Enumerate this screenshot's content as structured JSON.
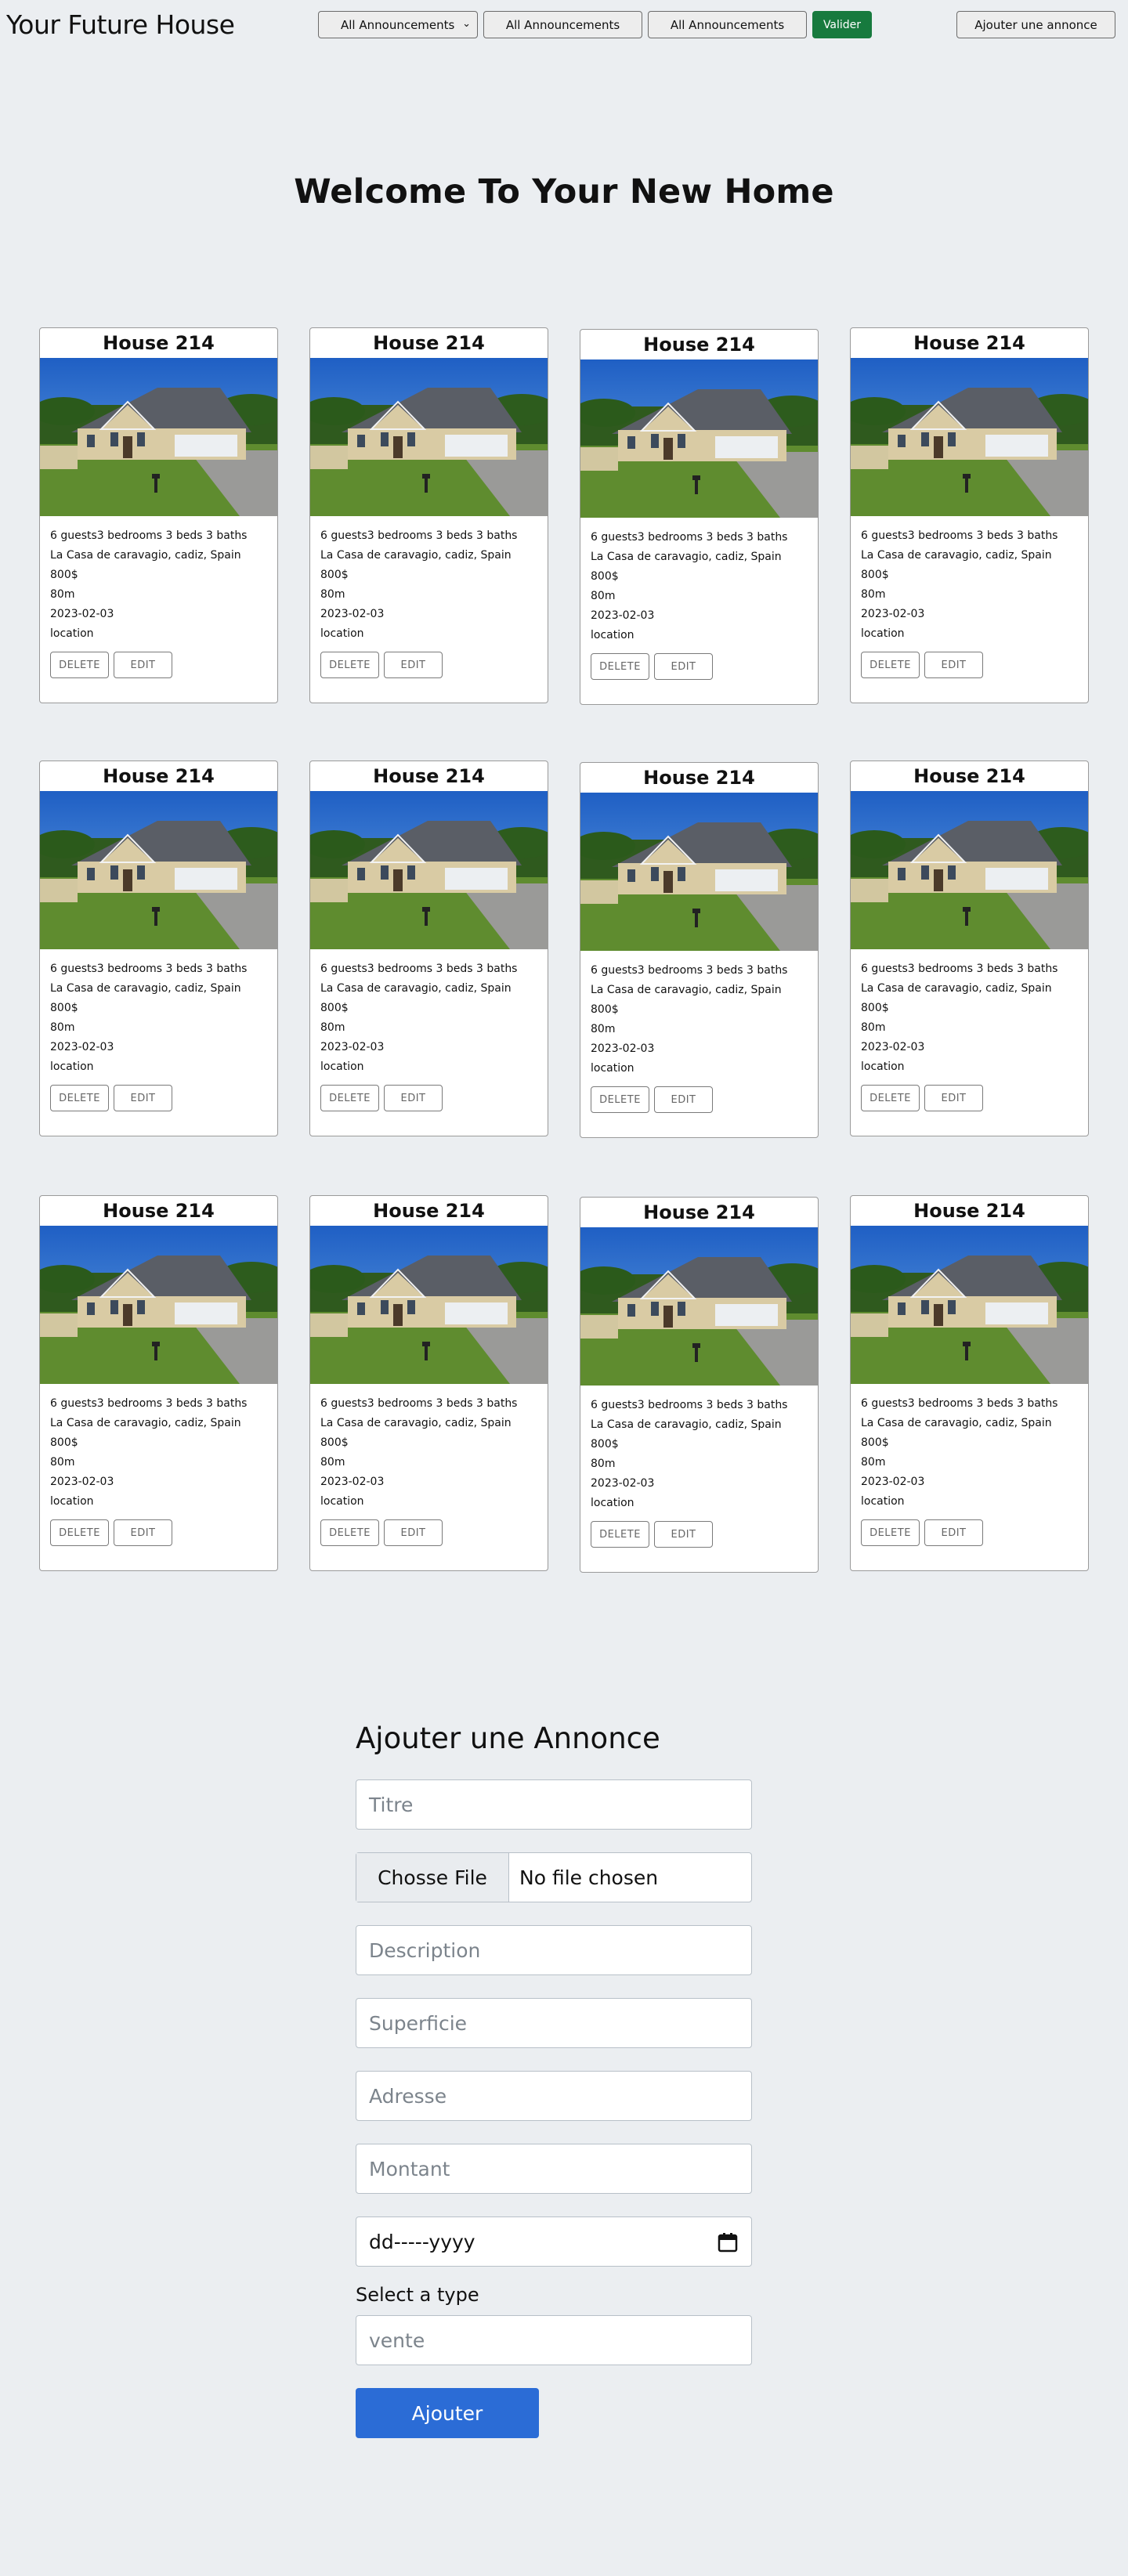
{
  "header": {
    "site_title": "Your Future House",
    "filter_select": "All Announcements",
    "button_2": "All Announcements",
    "button_3": "All Announcements",
    "valider": "Valider",
    "add_announcement": "Ajouter une annonce"
  },
  "welcome": "Welcome To Your New Home",
  "cards": [
    {
      "title": "House 214",
      "guests": "6 guests3 bedrooms 3 beds 3 baths",
      "address": "La Casa de caravagio, cadiz, Spain",
      "price": "800$",
      "area": "80m",
      "date": "2023-02-03",
      "location": "location",
      "delete": "DELETE",
      "edit": "EDIT"
    },
    {
      "title": "House 214",
      "guests": "6 guests3 bedrooms 3 beds 3 baths",
      "address": "La Casa de caravagio, cadiz, Spain",
      "price": "800$",
      "area": "80m",
      "date": "2023-02-03",
      "location": "location",
      "delete": "DELETE",
      "edit": "EDIT"
    },
    {
      "title": "House 214",
      "guests": "6 guests3 bedrooms 3 beds 3 baths",
      "address": "La Casa de caravagio, cadiz, Spain",
      "price": "800$",
      "area": "80m",
      "date": "2023-02-03",
      "location": "location",
      "delete": "DELETE",
      "edit": "EDIT"
    },
    {
      "title": "House 214",
      "guests": "6 guests3 bedrooms 3 beds 3 baths",
      "address": "La Casa de caravagio, cadiz, Spain",
      "price": "800$",
      "area": "80m",
      "date": "2023-02-03",
      "location": "location",
      "delete": "DELETE",
      "edit": "EDIT"
    },
    {
      "title": "House 214",
      "guests": "6 guests3 bedrooms 3 beds 3 baths",
      "address": "La Casa de caravagio, cadiz, Spain",
      "price": "800$",
      "area": "80m",
      "date": "2023-02-03",
      "location": "location",
      "delete": "DELETE",
      "edit": "EDIT"
    },
    {
      "title": "House 214",
      "guests": "6 guests3 bedrooms 3 beds 3 baths",
      "address": "La Casa de caravagio, cadiz, Spain",
      "price": "800$",
      "area": "80m",
      "date": "2023-02-03",
      "location": "location",
      "delete": "DELETE",
      "edit": "EDIT"
    },
    {
      "title": "House 214",
      "guests": "6 guests3 bedrooms 3 beds 3 baths",
      "address": "La Casa de caravagio, cadiz, Spain",
      "price": "800$",
      "area": "80m",
      "date": "2023-02-03",
      "location": "location",
      "delete": "DELETE",
      "edit": "EDIT"
    },
    {
      "title": "House 214",
      "guests": "6 guests3 bedrooms 3 beds 3 baths",
      "address": "La Casa de caravagio, cadiz, Spain",
      "price": "800$",
      "area": "80m",
      "date": "2023-02-03",
      "location": "location",
      "delete": "DELETE",
      "edit": "EDIT"
    },
    {
      "title": "House 214",
      "guests": "6 guests3 bedrooms 3 beds 3 baths",
      "address": "La Casa de caravagio, cadiz, Spain",
      "price": "800$",
      "area": "80m",
      "date": "2023-02-03",
      "location": "location",
      "delete": "DELETE",
      "edit": "EDIT"
    },
    {
      "title": "House 214",
      "guests": "6 guests3 bedrooms 3 beds 3 baths",
      "address": "La Casa de caravagio, cadiz, Spain",
      "price": "800$",
      "area": "80m",
      "date": "2023-02-03",
      "location": "location",
      "delete": "DELETE",
      "edit": "EDIT"
    },
    {
      "title": "House 214",
      "guests": "6 guests3 bedrooms 3 beds 3 baths",
      "address": "La Casa de caravagio, cadiz, Spain",
      "price": "800$",
      "area": "80m",
      "date": "2023-02-03",
      "location": "location",
      "delete": "DELETE",
      "edit": "EDIT"
    },
    {
      "title": "House 214",
      "guests": "6 guests3 bedrooms 3 beds 3 baths",
      "address": "La Casa de caravagio, cadiz, Spain",
      "price": "800$",
      "area": "80m",
      "date": "2023-02-03",
      "location": "location",
      "delete": "DELETE",
      "edit": "EDIT"
    }
  ],
  "form": {
    "title": "Ajouter une Annonce",
    "titre_placeholder": "Titre",
    "file_button": "Chosse File",
    "file_status": "No file chosen",
    "description_placeholder": "Description",
    "superficie_placeholder": "Superficie",
    "adresse_placeholder": "Adresse",
    "montant_placeholder": "Montant",
    "date_placeholder": "dd-----yyyy",
    "type_label": "Select a type",
    "type_value": "vente",
    "submit": "Ajouter"
  },
  "colors": {
    "background": "#ebeef1",
    "valider": "#177a3e",
    "submit": "#2b6cd6"
  }
}
